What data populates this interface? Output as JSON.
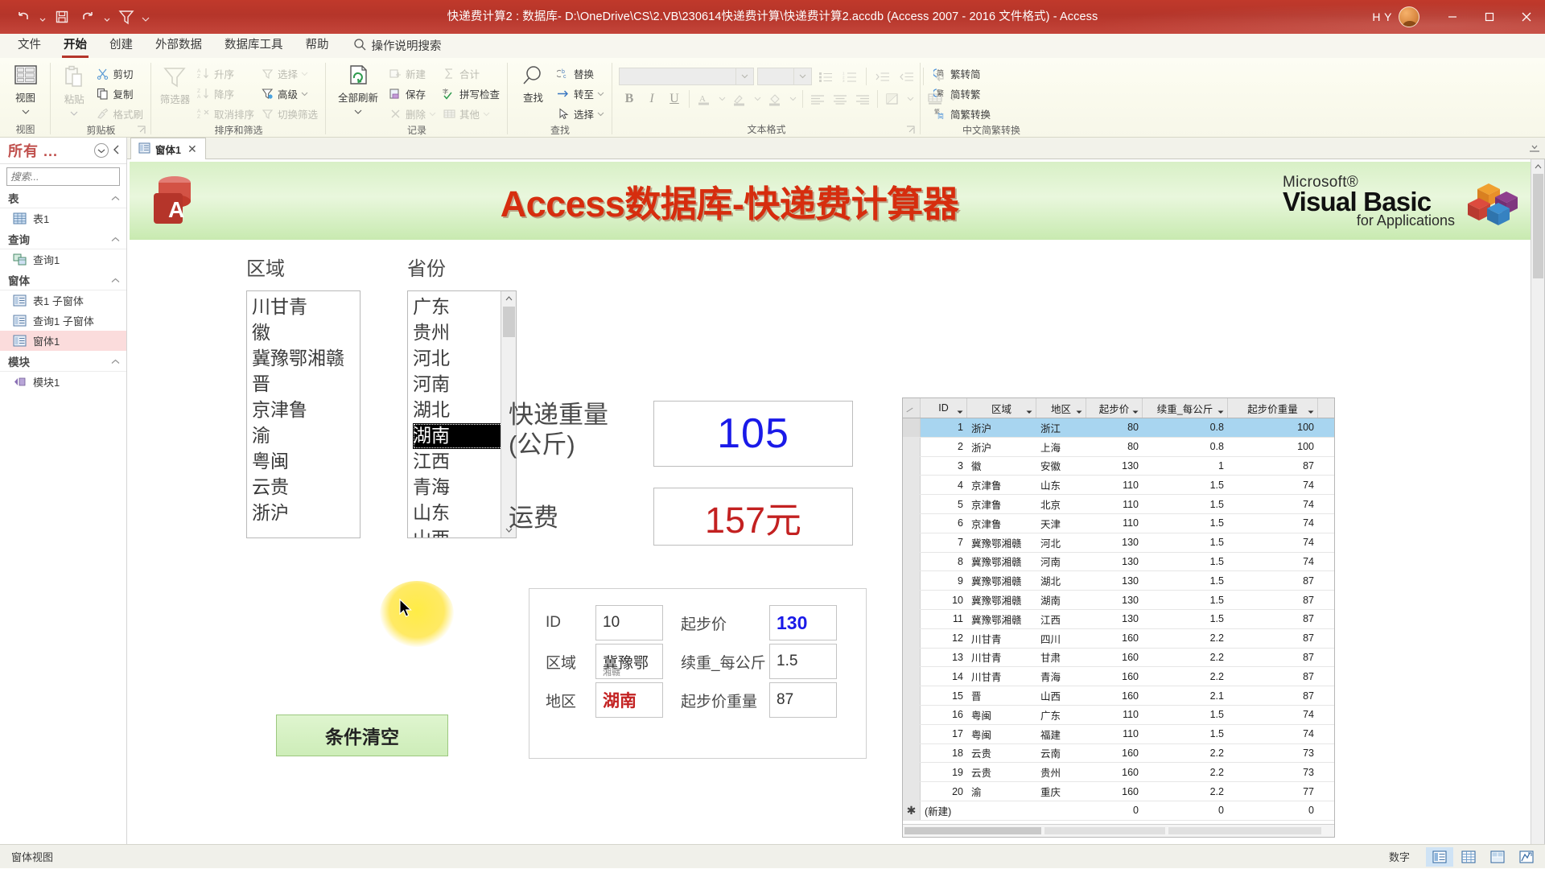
{
  "titlebar": {
    "title": "快递费计算2 : 数据库- D:\\OneDrive\\CS\\2.VB\\230614快递费计算\\快递费计算2.accdb (Access 2007 - 2016 文件格式)  -  Access",
    "user": "H Y",
    "qat": [
      "undo-icon",
      "save-icon",
      "redo-icon",
      "filter-icon",
      "customize-qat-icon"
    ],
    "window_buttons": [
      "minimize",
      "restore",
      "close"
    ]
  },
  "ribbon": {
    "tabs": [
      {
        "label": "文件",
        "active": false
      },
      {
        "label": "开始",
        "active": true
      },
      {
        "label": "创建",
        "active": false
      },
      {
        "label": "外部数据",
        "active": false
      },
      {
        "label": "数据库工具",
        "active": false
      },
      {
        "label": "帮助",
        "active": false
      }
    ],
    "search_placeholder": "操作说明搜索",
    "groups": [
      {
        "name": "视图",
        "label": "视图",
        "big": [
          {
            "label": "视图",
            "dim": false
          }
        ]
      },
      {
        "name": "剪贴板",
        "label": "剪贴板",
        "big": [
          {
            "label": "粘贴",
            "dim": true
          }
        ],
        "items": [
          {
            "label": "剪切",
            "dim": false
          },
          {
            "label": "复制",
            "dim": false
          },
          {
            "label": "格式刷",
            "dim": true
          }
        ]
      },
      {
        "name": "排序和筛选",
        "label": "排序和筛选",
        "big": [
          {
            "label": "筛选器",
            "dim": true
          }
        ],
        "items": [
          {
            "label": "升序",
            "dim": true
          },
          {
            "label": "降序",
            "dim": true
          },
          {
            "label": "取消排序",
            "dim": true
          },
          {
            "label": "选择",
            "dim": true
          },
          {
            "label": "高级",
            "dim": false
          },
          {
            "label": "切换筛选",
            "dim": true
          }
        ]
      },
      {
        "name": "记录",
        "label": "记录",
        "big": [
          {
            "label": "全部刷新",
            "dim": false
          }
        ],
        "items": [
          {
            "label": "新建",
            "dim": true
          },
          {
            "label": "保存",
            "dim": false
          },
          {
            "label": "删除",
            "dim": true
          },
          {
            "label": "合计",
            "dim": true
          },
          {
            "label": "拼写检查",
            "dim": false
          },
          {
            "label": "其他",
            "dim": true
          }
        ]
      },
      {
        "name": "查找",
        "label": "查找",
        "big": [
          {
            "label": "查找",
            "dim": false
          }
        ],
        "items": [
          {
            "label": "替换",
            "dim": false
          },
          {
            "label": "转至",
            "dim": false
          },
          {
            "label": "选择",
            "dim": false
          }
        ]
      },
      {
        "name": "文本格式",
        "label": "文本格式",
        "items": []
      },
      {
        "name": "中文简繁转换",
        "label": "中文简繁转换",
        "items": [
          {
            "label": "繁转简",
            "dim": false
          },
          {
            "label": "简转繁",
            "dim": false
          },
          {
            "label": "简繁转换",
            "dim": false
          }
        ]
      }
    ]
  },
  "navpane": {
    "title": "所有 ...",
    "search_placeholder": "搜索...",
    "groups": [
      {
        "label": "表",
        "items": [
          {
            "label": "表1",
            "icon": "table-icon",
            "selected": false
          }
        ]
      },
      {
        "label": "查询",
        "items": [
          {
            "label": "查询1",
            "icon": "query-icon",
            "selected": false
          }
        ]
      },
      {
        "label": "窗体",
        "items": [
          {
            "label": "表1 子窗体",
            "icon": "form-icon",
            "selected": false
          },
          {
            "label": "查询1 子窗体",
            "icon": "form-icon",
            "selected": false
          },
          {
            "label": "窗体1",
            "icon": "form-icon",
            "selected": true
          }
        ]
      },
      {
        "label": "模块",
        "items": [
          {
            "label": "模块1",
            "icon": "module-icon",
            "selected": false
          }
        ]
      }
    ]
  },
  "doctab": {
    "label": "窗体1",
    "close": "✕"
  },
  "form": {
    "banner": {
      "title": "Access数据库-快递费计算器",
      "logo_letter": "A",
      "vba": {
        "ms": "Microsoft®",
        "main": "Visual Basic",
        "sub": "for Applications"
      }
    },
    "labels": {
      "area": "区域",
      "province": "省份"
    },
    "area_list": [
      "川甘青",
      "徽",
      "冀豫鄂湘赣",
      "晋",
      "京津鲁",
      "渝",
      "粤闽",
      "云贵",
      "浙沪"
    ],
    "province_list": [
      "广东",
      "贵州",
      "河北",
      "河南",
      "湖北",
      "湖南",
      "江西",
      "青海",
      "山东",
      "山西"
    ],
    "province_selected": "湖南",
    "clear_button": "条件清空",
    "weight": {
      "label": "快递重量\n(公斤)",
      "label_line1": "快递重量",
      "label_line2": "(公斤)",
      "value": "105"
    },
    "fee": {
      "label": "运费",
      "value": "157元"
    },
    "detail": {
      "id_label": "ID",
      "id_value": "10",
      "area_label": "区域",
      "area_value": "冀豫鄂",
      "area_overflow": "湘赣",
      "region_label": "地区",
      "region_value": "湖南",
      "base_label": "起步价",
      "base_value": "130",
      "per_label": "续重_每公斤",
      "per_value": "1.5",
      "base_weight_label": "起步价重量",
      "base_weight_value": "87"
    }
  },
  "datasheet": {
    "columns": [
      "ID",
      "区域",
      "地区",
      "起步价",
      "续重_每公斤",
      "起步价重量"
    ],
    "rows": [
      {
        "id": "1",
        "area": "浙沪",
        "region": "浙江",
        "base": "80",
        "per": "0.8",
        "wt": "100",
        "selected": true
      },
      {
        "id": "2",
        "area": "浙沪",
        "region": "上海",
        "base": "80",
        "per": "0.8",
        "wt": "100",
        "selected": false
      },
      {
        "id": "3",
        "area": "徽",
        "region": "安徽",
        "base": "130",
        "per": "1",
        "wt": "87",
        "selected": false
      },
      {
        "id": "4",
        "area": "京津鲁",
        "region": "山东",
        "base": "110",
        "per": "1.5",
        "wt": "74",
        "selected": false
      },
      {
        "id": "5",
        "area": "京津鲁",
        "region": "北京",
        "base": "110",
        "per": "1.5",
        "wt": "74",
        "selected": false
      },
      {
        "id": "6",
        "area": "京津鲁",
        "region": "天津",
        "base": "110",
        "per": "1.5",
        "wt": "74",
        "selected": false
      },
      {
        "id": "7",
        "area": "冀豫鄂湘赣",
        "region": "河北",
        "base": "130",
        "per": "1.5",
        "wt": "74",
        "selected": false
      },
      {
        "id": "8",
        "area": "冀豫鄂湘赣",
        "region": "河南",
        "base": "130",
        "per": "1.5",
        "wt": "74",
        "selected": false
      },
      {
        "id": "9",
        "area": "冀豫鄂湘赣",
        "region": "湖北",
        "base": "130",
        "per": "1.5",
        "wt": "87",
        "selected": false
      },
      {
        "id": "10",
        "area": "冀豫鄂湘赣",
        "region": "湖南",
        "base": "130",
        "per": "1.5",
        "wt": "87",
        "selected": false
      },
      {
        "id": "11",
        "area": "冀豫鄂湘赣",
        "region": "江西",
        "base": "130",
        "per": "1.5",
        "wt": "87",
        "selected": false
      },
      {
        "id": "12",
        "area": "川甘青",
        "region": "四川",
        "base": "160",
        "per": "2.2",
        "wt": "87",
        "selected": false
      },
      {
        "id": "13",
        "area": "川甘青",
        "region": "甘肃",
        "base": "160",
        "per": "2.2",
        "wt": "87",
        "selected": false
      },
      {
        "id": "14",
        "area": "川甘青",
        "region": "青海",
        "base": "160",
        "per": "2.2",
        "wt": "87",
        "selected": false
      },
      {
        "id": "15",
        "area": "晋",
        "region": "山西",
        "base": "160",
        "per": "2.1",
        "wt": "87",
        "selected": false
      },
      {
        "id": "16",
        "area": "粤闽",
        "region": "广东",
        "base": "110",
        "per": "1.5",
        "wt": "74",
        "selected": false
      },
      {
        "id": "17",
        "area": "粤闽",
        "region": "福建",
        "base": "110",
        "per": "1.5",
        "wt": "74",
        "selected": false
      },
      {
        "id": "18",
        "area": "云贵",
        "region": "云南",
        "base": "160",
        "per": "2.2",
        "wt": "73",
        "selected": false
      },
      {
        "id": "19",
        "area": "云贵",
        "region": "贵州",
        "base": "160",
        "per": "2.2",
        "wt": "73",
        "selected": false
      },
      {
        "id": "20",
        "area": "渝",
        "region": "重庆",
        "base": "160",
        "per": "2.2",
        "wt": "77",
        "selected": false
      }
    ],
    "new_row": {
      "id": "(新建)",
      "area": "",
      "region": "",
      "base": "0",
      "per": "0",
      "wt": "0"
    }
  },
  "statusbar": {
    "left": "窗体视图",
    "mode": "数字",
    "views": [
      "form-view-icon",
      "datasheet-view-icon",
      "layout-view-icon",
      "design-view-icon"
    ]
  },
  "colors": {
    "title_red": "#b5352a",
    "banner_green": "#d8f0c6",
    "heading_red": "#d62d0e",
    "value_blue": "#1a1ae8",
    "fee_red": "#c32121",
    "row_select": "#a8d5f0",
    "nav_select": "#fbdcdc"
  }
}
